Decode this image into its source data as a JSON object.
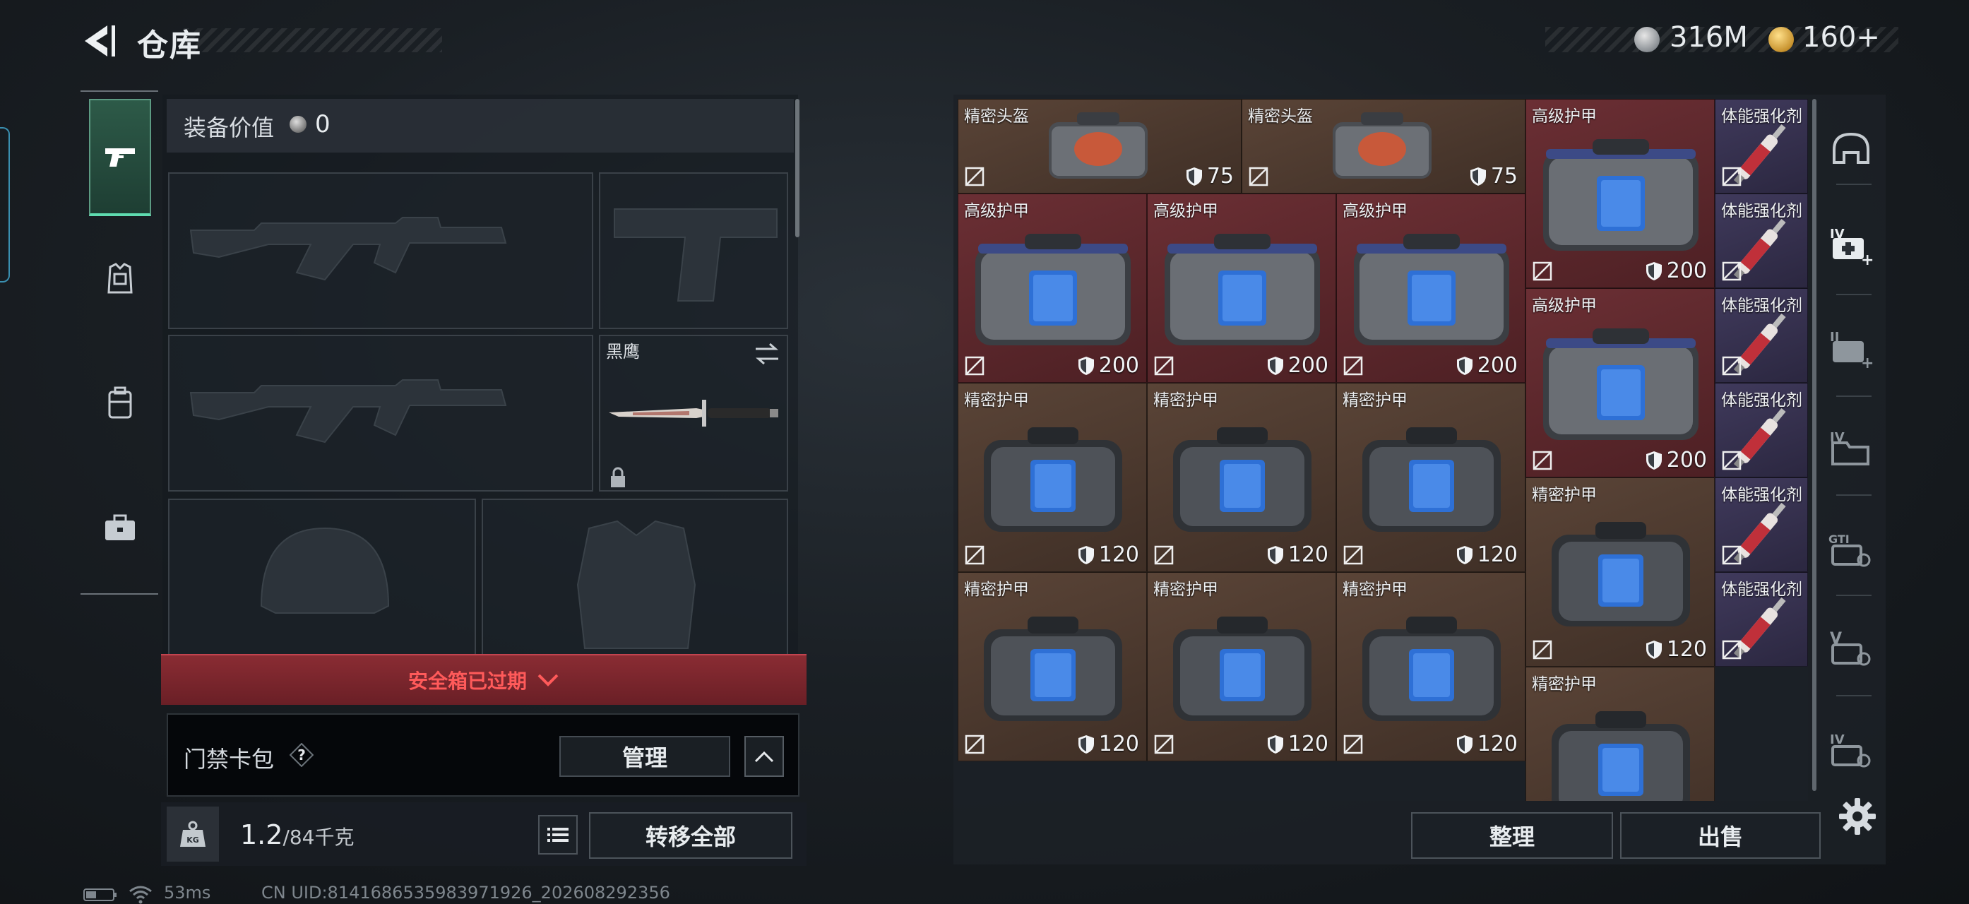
{
  "header": {
    "title": "仓库",
    "currency_silver": "316M",
    "currency_gold": "160+"
  },
  "equip": {
    "value_label": "装备价值",
    "value": "0",
    "melee_name": "黑鹰"
  },
  "safe_box": {
    "label": "安全箱已过期"
  },
  "access_card": {
    "label": "门禁卡包",
    "help": "?",
    "manage": "管理"
  },
  "capacity": {
    "weight": "1.2",
    "max": "/84千克"
  },
  "buttons": {
    "transfer_all": "转移全部",
    "sort": "整理",
    "sell": "出售"
  },
  "status_bar": {
    "ping": "53ms",
    "uid": "CN UID:8141686535983971926_202608292356"
  },
  "items": [
    {
      "name": "精密头盔",
      "durability": "75"
    },
    {
      "name": "精密头盔",
      "durability": "75"
    },
    {
      "name": "高级护甲",
      "durability": "200"
    },
    {
      "name": "体能强化剂",
      "durability": ""
    },
    {
      "name": "高级护甲",
      "durability": "200"
    },
    {
      "name": "高级护甲",
      "durability": "200"
    },
    {
      "name": "高级护甲",
      "durability": "200"
    },
    {
      "name": "体能强化剂",
      "durability": ""
    },
    {
      "name": "高级护甲",
      "durability": "200"
    },
    {
      "name": "体能强化剂",
      "durability": ""
    },
    {
      "name": "精密护甲",
      "durability": "120"
    },
    {
      "name": "精密护甲",
      "durability": "120"
    },
    {
      "name": "精密护甲",
      "durability": "120"
    },
    {
      "name": "体能强化剂",
      "durability": ""
    },
    {
      "name": "精密护甲",
      "durability": "120"
    },
    {
      "name": "体能强化剂",
      "durability": ""
    },
    {
      "name": "精密护甲",
      "durability": "120"
    },
    {
      "name": "精密护甲",
      "durability": "120"
    },
    {
      "name": "精密护甲",
      "durability": "120"
    },
    {
      "name": "体能强化剂",
      "durability": ""
    },
    {
      "name": "精密护甲",
      "durability": ""
    }
  ]
}
